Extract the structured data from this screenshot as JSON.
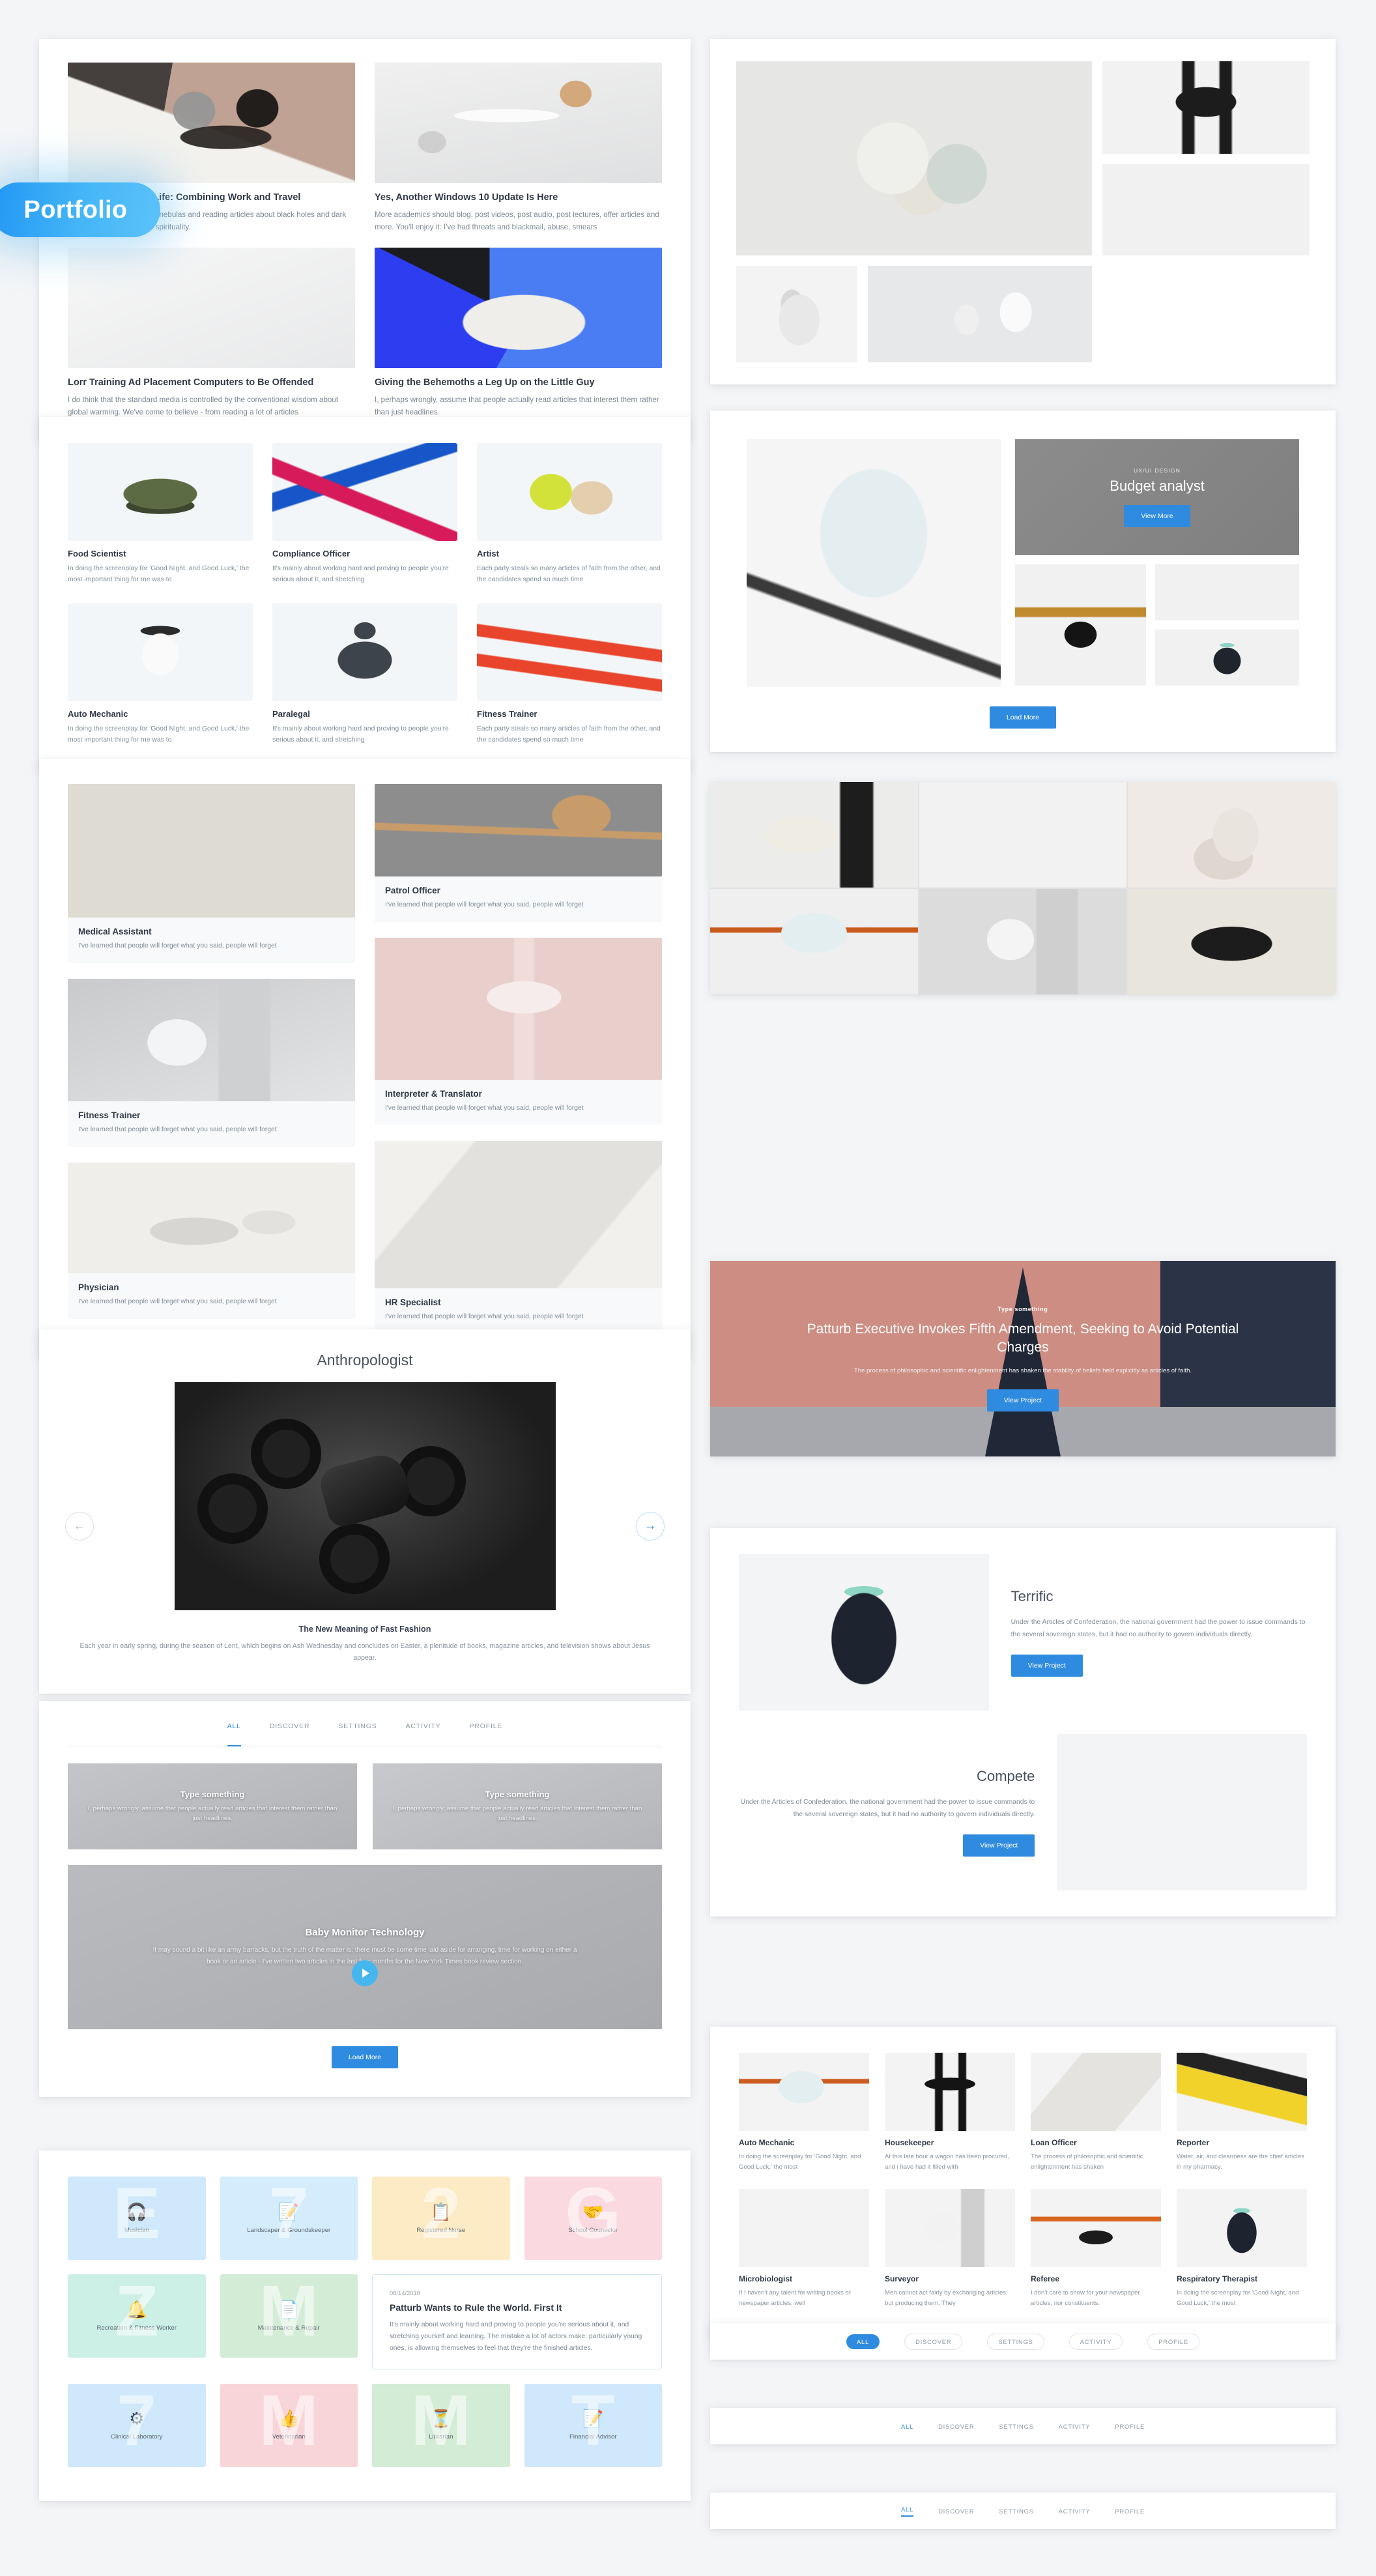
{
  "ribbon": {
    "label": "Portfolio"
  },
  "blog": {
    "posts": [
      {
        "title": "The Digital Nomad Life: Combining Work and Travel",
        "excerpt": "I love looking at pictures of nebulas and reading articles about black holes and dark matter - I always tie it into spirituality."
      },
      {
        "title": "Yes, Another Windows 10 Update Is Here",
        "excerpt": "More academics should blog, post videos, post audio, post lectures, offer articles and more. You'll enjoy it: I've had threats and blackmail, abuse, smears"
      },
      {
        "title": "Lorr Training Ad Placement Computers to Be Offended",
        "excerpt": "I do think that the standard media is controlled by the conventional wisdom about global warming. We've come to believe - from reading a lot of articles"
      },
      {
        "title": "Giving the Behemoths a Leg Up on the Little Guy",
        "excerpt": "I, perhaps wrongly, assume that people actually read articles that interest them rather than just headlines."
      }
    ]
  },
  "product_grid": {
    "items": [
      {
        "title": "Food Scientist",
        "text": "In doing the screenplay for 'Good Night, and Good Luck,' the most important thing for me was to"
      },
      {
        "title": "Compliance Officer",
        "text": "It's mainly about working hard and proving to people you're serious about it, and stretching"
      },
      {
        "title": "Artist",
        "text": "Each party steals so many articles of faith from the other, and the candidates spend so much time"
      },
      {
        "title": "Auto Mechanic",
        "text": "In doing the screenplay for 'Good Night, and Good Luck,' the most important thing for me was to"
      },
      {
        "title": "Paralegal",
        "text": "It's mainly about working hard and proving to people you're serious about it, and stretching"
      },
      {
        "title": "Fitness Trainer",
        "text": "Each party steals so many articles of faith from the other, and the candidates spend so much time"
      }
    ]
  },
  "masonry": {
    "shared_excerpt": "I've learned that people will forget what you said, people will forget",
    "left": [
      {
        "title": "Medical Assistant"
      },
      {
        "title": "Fitness Trainer"
      },
      {
        "title": "Physician"
      }
    ],
    "right": [
      {
        "title": "Patrol Officer"
      },
      {
        "title": "Interpreter & Translator"
      },
      {
        "title": "HR Specialist"
      }
    ]
  },
  "carousel": {
    "title": "Anthropologist",
    "caption": "The New Meaning of Fast Fashion",
    "description": "Each year in early spring, during the season of Lent, which begins on Ash Wednesday and concludes on Easter, a plenitude of books, magazine articles, and television shows about Jesus appear.",
    "prev_icon": "arrow-left-icon",
    "next_icon": "arrow-right-icon"
  },
  "tabs_card": {
    "tabs": [
      "ALL",
      "DISCOVER",
      "SETTINGS",
      "ACTIVITY",
      "PROFILE"
    ],
    "active_tab": "ALL",
    "tiles": [
      {
        "title": "Type something",
        "text": "I, perhaps wrongly, assume that people actually read articles that interest them rather than just headlines."
      },
      {
        "title": "Type something",
        "text": "I, perhaps wrongly, assume that people actually read articles that interest them rather than just headlines."
      }
    ],
    "feature": {
      "title": "Baby Monitor Technology",
      "text": "It may sound a bit like an army barracks, but the truth of the matter is: there must be some time laid aside for arranging, time for working on either a book or an article - I've written two articles in the last four months for the New York Times book review section.",
      "play_icon": "play-icon"
    },
    "load_more": "Load More"
  },
  "icon_grid": {
    "cells": [
      {
        "label": "Musician",
        "glyph": "🎧",
        "bg": "#cfe8fb",
        "letter": "E"
      },
      {
        "label": "Landscaper & Groundskeeper",
        "glyph": "📝",
        "bg": "#d4ecfb",
        "letter": "7"
      },
      {
        "label": "Registered Nurse",
        "glyph": "📋",
        "bg": "#fdebc6",
        "letter": "2"
      },
      {
        "label": "School Counselor",
        "glyph": "🤝",
        "bg": "#fbd9e1",
        "letter": "G"
      },
      {
        "label": "Recreation & Fitness Worker",
        "glyph": "🔔",
        "bg": "#ccefe6",
        "letter": "Z"
      },
      {
        "label": "Maintenance & Repair",
        "glyph": "📄",
        "bg": "#d3ecd5",
        "letter": "M"
      },
      {
        "label": "Clinical Laboratory",
        "glyph": "⚙",
        "bg": "#cfe8fb",
        "letter": "7"
      },
      {
        "label": "Veterinarian",
        "glyph": "👍",
        "bg": "#f8d5d8",
        "letter": "M"
      },
      {
        "label": "Librarian",
        "glyph": "⏳",
        "bg": "#d3ecd5",
        "letter": "M"
      },
      {
        "label": "Financial Advisor",
        "glyph": "📝",
        "bg": "#cfe8fb",
        "letter": "T"
      }
    ],
    "feature": {
      "date": "08/14/2018",
      "title": "Patturb Wants to Rule the World. First It",
      "text": "It's mainly about working hard and proving to people you're serious about it, and stretching yourself and learning. The mistake a lot of actors make, particularly young ones, is allowing themselves to feel that they're the finished articles,"
    }
  },
  "budget": {
    "eyebrow": "UX/UI DESIGN",
    "title": "Budget analyst",
    "view_more": "View More",
    "load_more": "Load More"
  },
  "hero": {
    "eyebrow": "Type something",
    "title": "Patturb Executive Invokes Fifth Amendment, Seeking to Avoid Potential Charges",
    "text": "The process of philosophic and scientific enlightenment has shaken the stability of beliefs held explicitly as articles of faith.",
    "cta": "View Project"
  },
  "terrific": {
    "title": "Terrific",
    "text": "Under the Articles of Confederation, the national government had the power to issue commands to the several sovereign states, but it had no authority to govern individuals directly.",
    "cta": "View Project"
  },
  "compete": {
    "title": "Compete",
    "text": "Under the Articles of Confederation, the national government had the power to issue commands to the several sovereign states, but it had no authority to govern individuals directly.",
    "cta": "View Project"
  },
  "bottom_grid": {
    "items": [
      {
        "title": "Auto Mechanic",
        "text": "In doing the screenplay for 'Good Night, and Good Luck,' the most"
      },
      {
        "title": "Housekeeper",
        "text": "At this late hour a wagon has been procured, and i have had it filled with"
      },
      {
        "title": "Loan Officer",
        "text": "The process of philosophic and scientific enlightenment has shaken"
      },
      {
        "title": "Reporter",
        "text": "Water, air, and cleanness are the chief articles in my pharmacy."
      },
      {
        "title": "Microbiologist",
        "text": "If I haven't any talent for writing books or newspaper articles, well"
      },
      {
        "title": "Surveyor",
        "text": "Men cannot act fairly by exchanging articles, but producing them. They"
      },
      {
        "title": "Referee",
        "text": "I don't care to show for your newspaper articles, nor constituents."
      },
      {
        "title": "Respiratory Therapist",
        "text": "In doing the screenplay for 'Good Night, and Good Luck,' the most"
      }
    ]
  },
  "tab_bars": [
    {
      "style": "pill",
      "tabs": [
        "ALL",
        "DISCOVER",
        "SETTINGS",
        "ACTIVITY",
        "PROFILE"
      ],
      "active": "ALL"
    },
    {
      "style": "plain",
      "tabs": [
        "ALL",
        "DISCOVER",
        "SETTINGS",
        "ACTIVITY",
        "PROFILE"
      ],
      "active": "ALL"
    },
    {
      "style": "underline",
      "tabs": [
        "ALL",
        "DISCOVER",
        "SETTINGS",
        "ACTIVITY",
        "PROFILE"
      ],
      "active": "ALL"
    }
  ],
  "colors": {
    "accent": "#2e8bdf",
    "accent_light": "#46b6ef",
    "text": "#2f3a46",
    "muted": "#8a949e"
  }
}
